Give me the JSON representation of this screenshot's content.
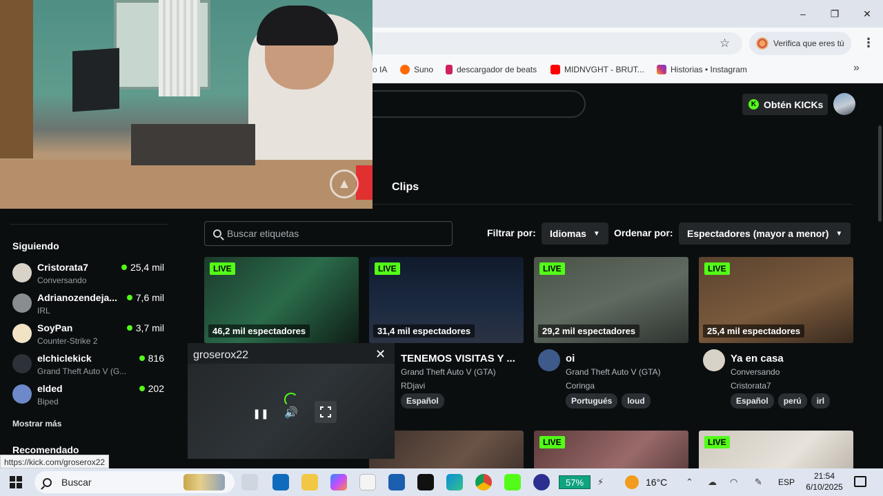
{
  "browser": {
    "window_controls": [
      "–",
      "❐",
      "✕"
    ],
    "verify_label": "Verifica que eres tú",
    "bookmarks": [
      {
        "label": "o IA",
        "color": "#7b61ff"
      },
      {
        "label": "Suno",
        "color": "#ff6a00"
      },
      {
        "label": "descargador de beats",
        "color": "#d0205d"
      },
      {
        "label": "MIDNVGHT - BRUT...",
        "color": "#ff0000"
      },
      {
        "label": "Historias • Instagram",
        "color": "#c13584"
      }
    ],
    "status_url": "https://kick.com/groserox22"
  },
  "header": {
    "kicks_label": "Obtén KICKs",
    "tab_clips": "Clips"
  },
  "sidebar": {
    "following_title": "Siguiendo",
    "items": [
      {
        "name": "Cristorata7",
        "sub": "Conversando",
        "count": "25,4 mil",
        "color": "#d9d2c8"
      },
      {
        "name": "Adrianozendeja...",
        "sub": "IRL",
        "count": "7,6 mil",
        "color": "#8a8d90"
      },
      {
        "name": "SoyPan",
        "sub": "Counter-Strike 2",
        "count": "3,7 mil",
        "color": "#f1e3c4"
      },
      {
        "name": "elchiclekick",
        "sub": "Grand Theft Auto V (G...",
        "count": "816",
        "color": "#2d3138"
      },
      {
        "name": "elded",
        "sub": "Biped",
        "count": "202",
        "color": "#6d89c9"
      }
    ],
    "show_more": "Mostrar más",
    "recommended_title": "Recomendado"
  },
  "filters": {
    "tag_placeholder": "Buscar etiquetas",
    "filter_label": "Filtrar por:",
    "filter_value": "Idiomas",
    "sort_label": "Ordenar por:",
    "sort_value": "Espectadores (mayor a menor)"
  },
  "cards": [
    {
      "live": "LIVE",
      "viewers": "46,2 mil espectadores",
      "title": "",
      "category": "",
      "user": "",
      "tags": [],
      "thumb": "#2a6b4a"
    },
    {
      "live": "LIVE",
      "viewers": "31,4 mil espectadores",
      "title": "TENEMOS VISITAS Y ...",
      "category": "Grand Theft Auto V (GTA)",
      "user": "RDjavi",
      "tags": [
        "Español"
      ],
      "thumb": "#1b2940"
    },
    {
      "live": "LIVE",
      "viewers": "29,2 mil espectadores",
      "title": "oi",
      "category": "Grand Theft Auto V (GTA)",
      "user": "Coringa",
      "tags": [
        "Portugués",
        "loud"
      ],
      "thumb": "#5f6a60"
    },
    {
      "live": "LIVE",
      "viewers": "25,4 mil espectadores",
      "title": "Ya en casa",
      "category": "Conversando",
      "user": "Cristorata7",
      "tags": [
        "Español",
        "perú",
        "irl"
      ],
      "thumb": "#7a5a3c"
    }
  ],
  "row2_live": [
    "LIVE",
    "LIVE"
  ],
  "mini_player": {
    "channel": "groserox22",
    "close": "✕",
    "pause": "❚❚",
    "volume": "🔊"
  },
  "taskbar": {
    "search_label": "Buscar",
    "battery": "57%",
    "temperature": "16°C",
    "lang": "ESP",
    "time": "21:54",
    "date": "6/10/2025"
  }
}
